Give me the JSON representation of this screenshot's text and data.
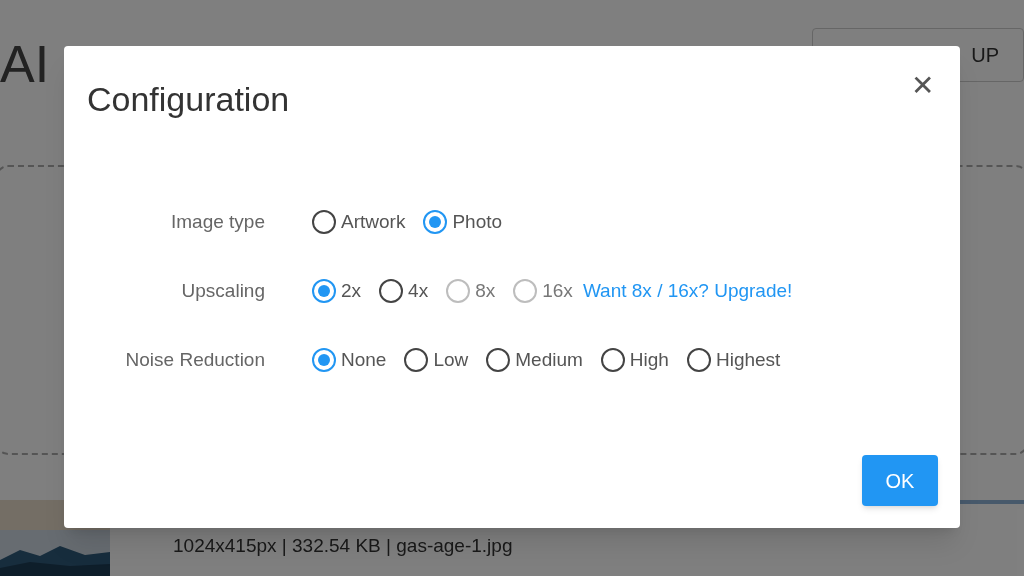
{
  "background": {
    "title": "AI",
    "signup_button": "UP",
    "file_info": "1024x415px | 332.54 KB | gas-age-1.jpg"
  },
  "dialog": {
    "title": "Configuration",
    "close": "✕",
    "rows": [
      {
        "label": "Image type",
        "options": [
          {
            "label": "Artwork",
            "selected": false,
            "disabled": false
          },
          {
            "label": "Photo",
            "selected": true,
            "disabled": false
          }
        ]
      },
      {
        "label": "Upscaling",
        "options": [
          {
            "label": "2x",
            "selected": true,
            "disabled": false
          },
          {
            "label": "4x",
            "selected": false,
            "disabled": false
          },
          {
            "label": "8x",
            "selected": false,
            "disabled": true
          },
          {
            "label": "16x",
            "selected": false,
            "disabled": true
          }
        ],
        "link": "Want 8x / 16x? Upgrade!"
      },
      {
        "label": "Noise Reduction",
        "options": [
          {
            "label": "None",
            "selected": true,
            "disabled": false
          },
          {
            "label": "Low",
            "selected": false,
            "disabled": false
          },
          {
            "label": "Medium",
            "selected": false,
            "disabled": false
          },
          {
            "label": "High",
            "selected": false,
            "disabled": false
          },
          {
            "label": "Highest",
            "selected": false,
            "disabled": false
          }
        ]
      }
    ],
    "ok_button": "OK"
  }
}
